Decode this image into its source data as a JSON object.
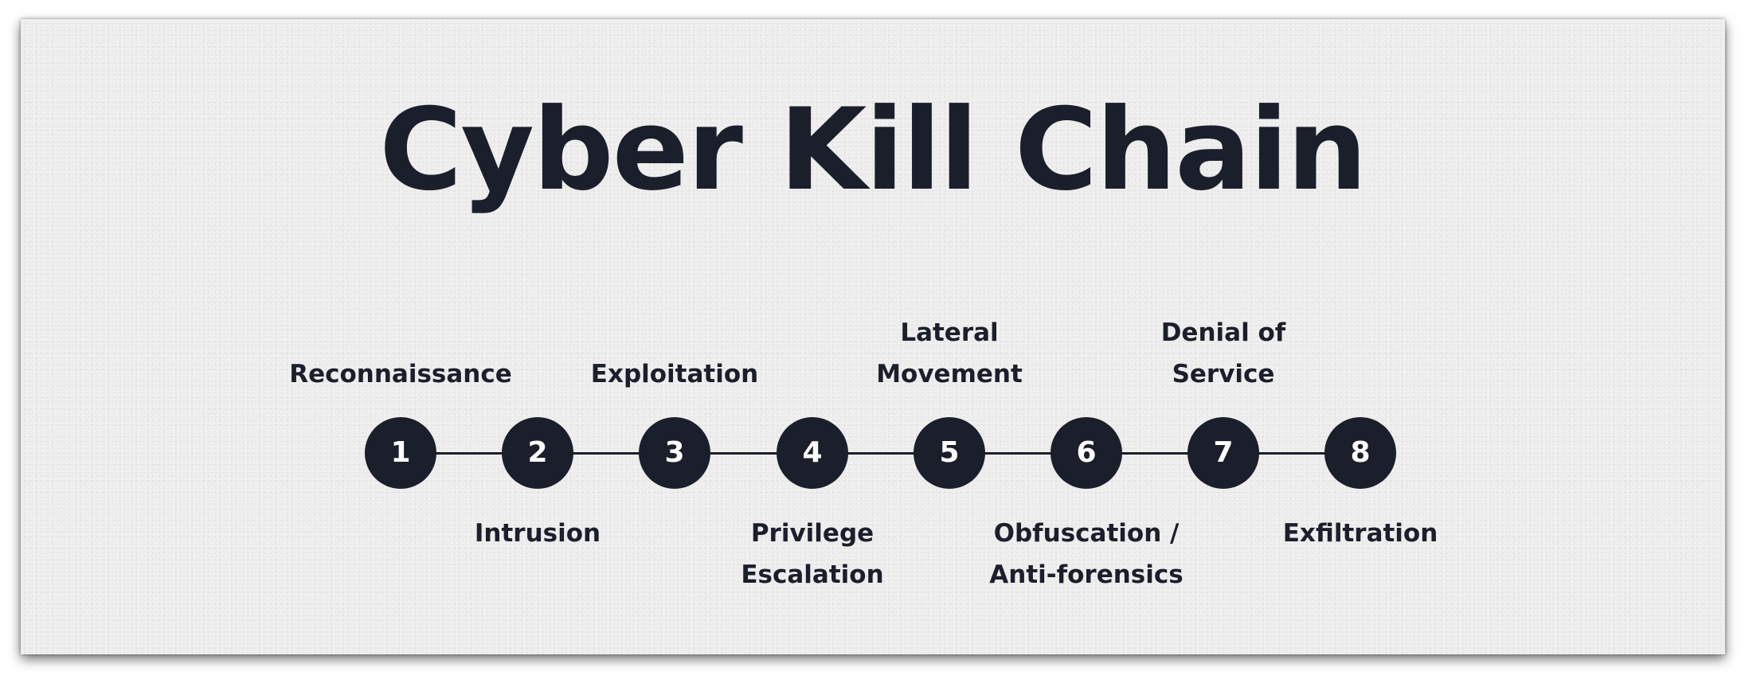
{
  "title": "Cyber Kill Chain",
  "colors": {
    "background": "#ececec",
    "ink": "#1b1f2b",
    "node_text": "#ffffff"
  },
  "steps": [
    {
      "number": "1",
      "label": [
        "Reconnaissance"
      ],
      "position": "above"
    },
    {
      "number": "2",
      "label": [
        "Intrusion"
      ],
      "position": "below"
    },
    {
      "number": "3",
      "label": [
        "Exploitation"
      ],
      "position": "above"
    },
    {
      "number": "4",
      "label": [
        "Privilege",
        "Escalation"
      ],
      "position": "below"
    },
    {
      "number": "5",
      "label": [
        "Lateral",
        "Movement"
      ],
      "position": "above"
    },
    {
      "number": "6",
      "label": [
        "Obfuscation /",
        "Anti-forensics"
      ],
      "position": "below"
    },
    {
      "number": "7",
      "label": [
        "Denial of",
        "Service"
      ],
      "position": "above"
    },
    {
      "number": "8",
      "label": [
        "Exfiltration"
      ],
      "position": "below"
    }
  ]
}
